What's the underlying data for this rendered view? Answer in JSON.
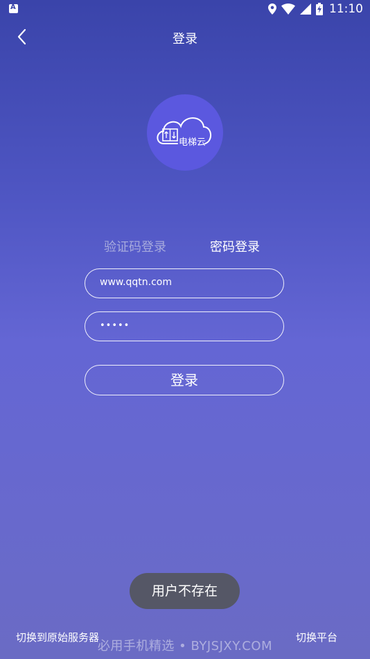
{
  "status_bar": {
    "time": "11:10",
    "icons": [
      "notification-a-icon",
      "location-icon",
      "wifi-icon",
      "cell-signal-icon",
      "battery-charging-icon"
    ]
  },
  "app_bar": {
    "back_icon": "chevron-left-icon",
    "title": "登录"
  },
  "logo": {
    "icon": "elevator-cloud-icon",
    "text": "电梯云",
    "circle_color": "#5b58df"
  },
  "tabs": [
    {
      "label": "验证码登录",
      "active": false
    },
    {
      "label": "密码登录",
      "active": true
    }
  ],
  "form": {
    "username_value": "www.qqtn.com",
    "password_value": "•••••",
    "login_label": "登录"
  },
  "toast": {
    "text": "用户不存在"
  },
  "footer": {
    "left_link": "切换到原始服务器",
    "right_link": "切换平台",
    "watermark": "必用手机精选 • BYJSJXY.COM"
  }
}
